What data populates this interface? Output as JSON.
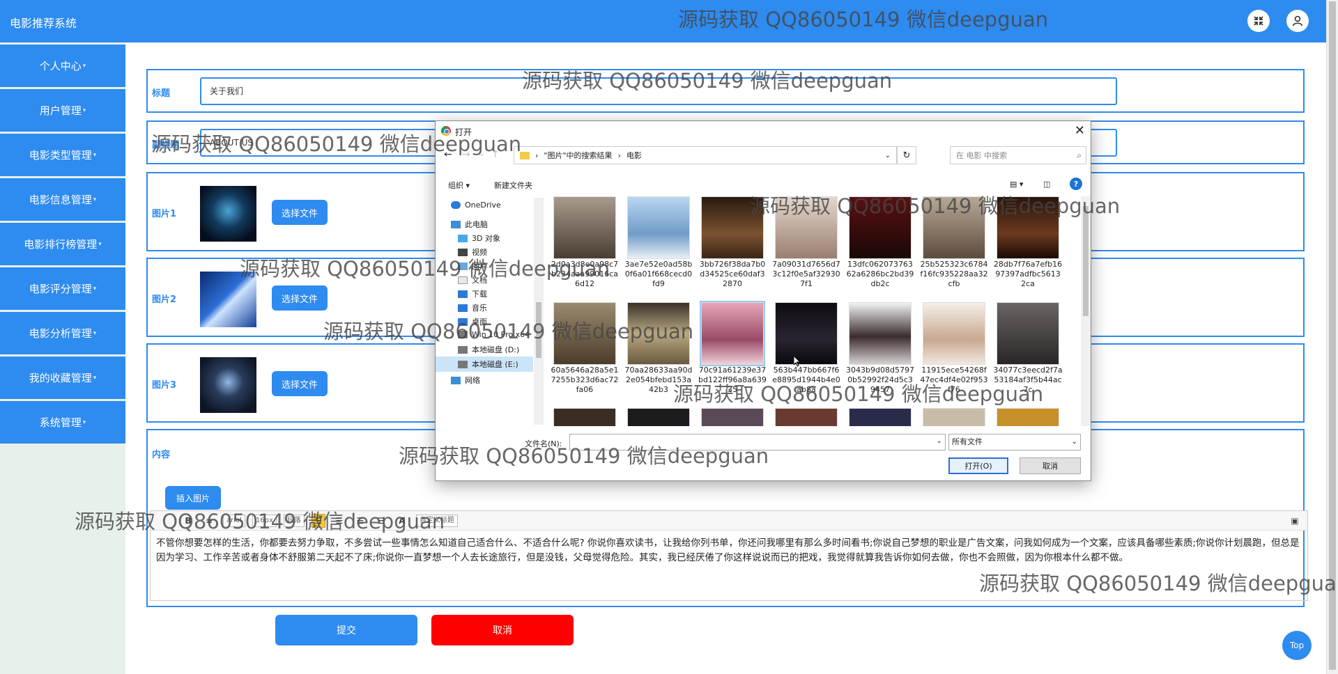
{
  "app": {
    "title": "电影推荐系统"
  },
  "topbar": {
    "fullscreen_icon": "fullscreen-exit-icon",
    "user_icon": "user-icon"
  },
  "sidebar": {
    "items": [
      {
        "label": "个人中心"
      },
      {
        "label": "用户管理"
      },
      {
        "label": "电影类型管理"
      },
      {
        "label": "电影信息管理"
      },
      {
        "label": "电影排行榜管理"
      },
      {
        "label": "电影评分管理"
      },
      {
        "label": "电影分析管理"
      },
      {
        "label": "我的收藏管理"
      },
      {
        "label": "系统管理"
      }
    ],
    "caret": "▾"
  },
  "form": {
    "title_label": "标题",
    "title_value": "关于我们",
    "subtitle_label": "副标题",
    "subtitle_value": "ABOUT US",
    "image1_label": "图片1",
    "image2_label": "图片2",
    "image3_label": "图片3",
    "choose_file": "选择文件",
    "content_label": "内容",
    "insert_image": "插入图片",
    "content_text": "不管你想要怎样的生活，你都要去努力争取，不多尝试一些事情怎么知道自己适合什么、不适合什么呢? 你说你喜欢读书，让我给你列书单，你还问我哪里有那么多时间看书;你说自己梦想的职业是广告文案，问我如何成为一个文案，应该具备哪些素质;你说你计划晨跑，但总是因为学习、工作辛苦或者身体不舒服第二天起不了床;你说你一直梦想一个人去长途旅行，但是没钱，父母觉得危险。其实，我已经厌倦了你这样说说而已的把戏，我觉得就算我告诉你如何去做，你也不会照做，因为你根本什么都不做。",
    "submit": "提交",
    "cancel": "取消"
  },
  "editor_toolbar": {
    "font_family": "arial",
    "font_size": "16px",
    "paragraph": "段落",
    "custom_title": "自定义标题",
    "bold": "B",
    "font_color": "A"
  },
  "top_button": "Top",
  "dialog": {
    "title": "打开",
    "close": "✕",
    "back": "←",
    "forward": "→",
    "recent": "⌄",
    "up": "↑",
    "breadcrumb": [
      "\"图片\"中的搜索结果",
      "电影"
    ],
    "refresh": "↻",
    "search_placeholder": "在 电影 中搜索",
    "organize": "组织 ▾",
    "new_folder": "新建文件夹",
    "help": "?",
    "nav_items": [
      {
        "label": "OneDrive",
        "icon": "cloud-icon"
      },
      {
        "label": "此电脑",
        "icon": "computer-icon"
      },
      {
        "label": "3D 对象",
        "icon": "3d-objects-icon"
      },
      {
        "label": "视频",
        "icon": "video-icon"
      },
      {
        "label": "图片",
        "icon": "pictures-icon"
      },
      {
        "label": "文档",
        "icon": "documents-icon"
      },
      {
        "label": "下载",
        "icon": "download-icon"
      },
      {
        "label": "音乐",
        "icon": "music-icon"
      },
      {
        "label": "桌面",
        "icon": "desktop-icon"
      },
      {
        "label": "Win 10 Pro x64",
        "icon": "drive-icon"
      },
      {
        "label": "本地磁盘 (D:)",
        "icon": "drive-icon"
      },
      {
        "label": "本地磁盘 (E:)",
        "icon": "drive-icon"
      },
      {
        "label": "网络",
        "icon": "network-icon"
      }
    ],
    "files": [
      {
        "name": "2d0a3d8e0a98c7b234aaa99016ca6d12",
        "color": "#6b5a4e"
      },
      {
        "name": "3ae7e52e0ad58b0f6a01f668cecd0fd9",
        "color": "#8fb6d9"
      },
      {
        "name": "3bb726f38da7b0d34525ce60daf32870",
        "color": "#5a3b22"
      },
      {
        "name": "7a09031d7656d73c12f0e5af329307f1",
        "color": "#c9b3a6"
      },
      {
        "name": "13dfc06207376362a6286bc2bd39db2c",
        "color": "#4a1414"
      },
      {
        "name": "25b525323c6784f16fc935228aa32cfb",
        "color": "#8a7866"
      },
      {
        "name": "28db7f76a7efb1697397adfbc56132ca",
        "color": "#3d1d12"
      },
      {
        "name": "60a5646a28a5e17255b323d6ac72fa06",
        "color": "#7d6a52"
      },
      {
        "name": "70aa28633aa90d2e054bfebd153a42b3",
        "color": "#8c7a5c"
      },
      {
        "name": "70c91a61239e37bd122ff96a8a63935",
        "color": "#c77c8f"
      },
      {
        "name": "563b447bb667f6e8895d1944b4e0ab8a",
        "color": "#1e1a22"
      },
      {
        "name": "3043b9d08d57970b52992f24d5c39457",
        "color": "#3a2c2c"
      },
      {
        "name": "11915ece54268f47ec4df4e02f953f76",
        "color": "#d9cfc4"
      },
      {
        "name": "34077c3eecd2f7a53184af3f5b44ac7c",
        "color": "#4c4a4a"
      }
    ],
    "file_name_label": "文件名(N):",
    "file_type": "所有文件",
    "open": "打开(O)",
    "cancel": "取消"
  },
  "watermark": "源码获取 QQ86050149 微信deepguan",
  "colors": {
    "primary": "#2e8bf0",
    "danger": "#ff0000",
    "sidebar_bg": "#e7f1ea"
  }
}
